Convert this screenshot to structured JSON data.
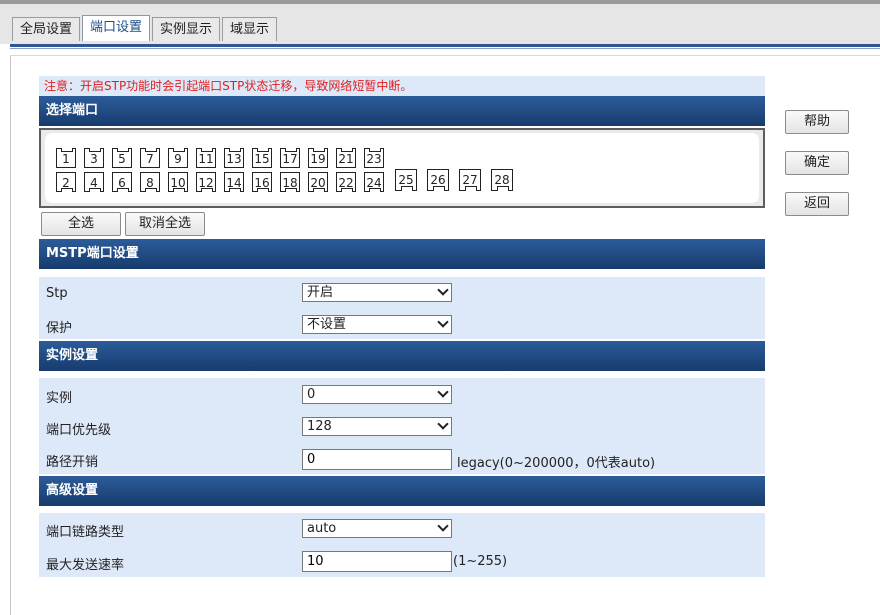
{
  "tabs": [
    {
      "label": "全局设置",
      "active": false
    },
    {
      "label": "端口设置",
      "active": true
    },
    {
      "label": "实例显示",
      "active": false
    },
    {
      "label": "域显示",
      "active": false
    }
  ],
  "notice": "注意：开启STP功能时会引起端口STP状态迁移，导致网络短暂中断。",
  "sections": {
    "port_select": "选择端口",
    "mstp": "MSTP端口设置",
    "instance": "实例设置",
    "advanced": "高级设置"
  },
  "ports": {
    "top_row": [
      "1",
      "3",
      "5",
      "7",
      "9",
      "11",
      "13",
      "15",
      "17",
      "19",
      "21",
      "23"
    ],
    "bottom_row": [
      "2",
      "4",
      "6",
      "8",
      "10",
      "12",
      "14",
      "16",
      "18",
      "20",
      "22",
      "24"
    ],
    "sfp": [
      "25",
      "26",
      "27",
      "28"
    ]
  },
  "buttons": {
    "select_all": "全选",
    "deselect_all": "取消全选",
    "help": "帮助",
    "confirm": "确定",
    "back": "返回"
  },
  "mstp": {
    "stp_label": "Stp",
    "stp_value": "开启",
    "protect_label": "保护",
    "protect_value": "不设置"
  },
  "instance": {
    "instance_label": "实例",
    "instance_value": "0",
    "priority_label": "端口优先级",
    "priority_value": "128",
    "path_cost_label": "路径开销",
    "path_cost_value": "0",
    "path_cost_hint": "legacy(0~200000，0代表auto)"
  },
  "advanced": {
    "link_type_label": "端口链路类型",
    "link_type_value": "auto",
    "max_rate_label": "最大发送速率",
    "max_rate_value": "10",
    "max_rate_hint": "(1~255)"
  },
  "colors": {
    "section_header": "#1f4a82",
    "row_background": "#dde9f8",
    "notice_text": "#e02020"
  }
}
